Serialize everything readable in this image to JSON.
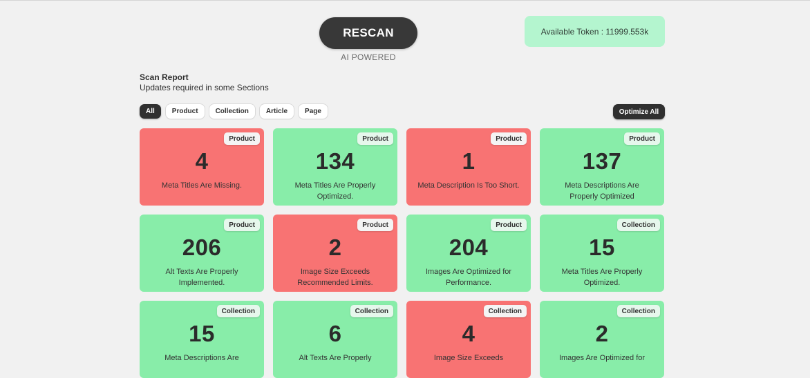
{
  "header": {
    "rescan_label": "RESCAN",
    "ai_powered": "AI POWERED",
    "token_text": "Available Token : 11999.553k"
  },
  "report": {
    "title": "Scan Report",
    "subtitle": "Updates required in some Sections"
  },
  "filters": [
    "All",
    "Product",
    "Collection",
    "Article",
    "Page"
  ],
  "active_filter": "All",
  "optimize_all_label": "Optimize All",
  "colors": {
    "red": "#f87373",
    "green": "#88eda9",
    "token_bg": "#b4f5cf",
    "dark": "#303030"
  },
  "cards": [
    {
      "tag": "Product",
      "count": "4",
      "label": "Meta Titles Are Missing.",
      "status": "red"
    },
    {
      "tag": "Product",
      "count": "134",
      "label": "Meta Titles Are Properly Optimized.",
      "status": "green"
    },
    {
      "tag": "Product",
      "count": "1",
      "label": "Meta Description Is Too Short.",
      "status": "red"
    },
    {
      "tag": "Product",
      "count": "137",
      "label": "Meta Descriptions Are Properly Optimized",
      "status": "green"
    },
    {
      "tag": "Product",
      "count": "206",
      "label": "Alt Texts Are Properly Implemented.",
      "status": "green"
    },
    {
      "tag": "Product",
      "count": "2",
      "label": "Image Size Exceeds Recommended Limits.",
      "status": "red"
    },
    {
      "tag": "Product",
      "count": "204",
      "label": "Images Are Optimized for Performance.",
      "status": "green"
    },
    {
      "tag": "Collection",
      "count": "15",
      "label": "Meta Titles Are Properly Optimized.",
      "status": "green"
    },
    {
      "tag": "Collection",
      "count": "15",
      "label": "Meta Descriptions Are",
      "status": "green"
    },
    {
      "tag": "Collection",
      "count": "6",
      "label": "Alt Texts Are Properly",
      "status": "green"
    },
    {
      "tag": "Collection",
      "count": "4",
      "label": "Image Size Exceeds",
      "status": "red"
    },
    {
      "tag": "Collection",
      "count": "2",
      "label": "Images Are Optimized for",
      "status": "green"
    }
  ]
}
